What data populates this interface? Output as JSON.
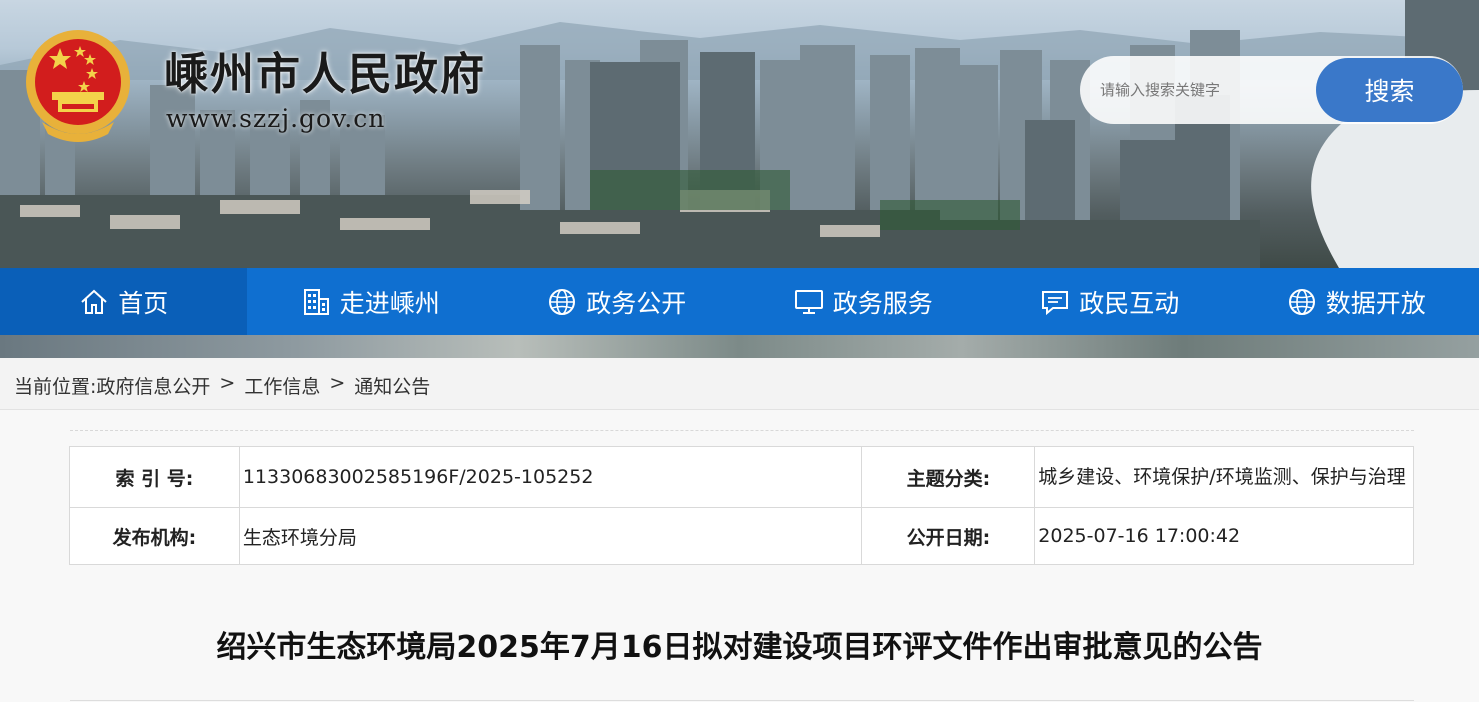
{
  "header": {
    "site_name": "嵊州市人民政府",
    "site_url": "www.szzj.gov.cn",
    "search_placeholder": "请输入搜索关键字",
    "search_button": "搜索"
  },
  "nav": {
    "items": [
      {
        "label": "首页",
        "icon": "home-icon"
      },
      {
        "label": "走进嵊州",
        "icon": "building-icon"
      },
      {
        "label": "政务公开",
        "icon": "globe-icon"
      },
      {
        "label": "政务服务",
        "icon": "monitor-icon"
      },
      {
        "label": "政民互动",
        "icon": "chat-icon"
      },
      {
        "label": "数据开放",
        "icon": "globe-icon"
      }
    ],
    "active_index": 0
  },
  "breadcrumb": {
    "prefix": "当前位置:",
    "items": [
      "政府信息公开",
      "工作信息",
      "通知公告"
    ],
    "separator": ">"
  },
  "info": {
    "index_label": "索 引 号:",
    "index_value": "11330683002585196F/2025-105252",
    "topic_label": "主题分类:",
    "topic_value": "城乡建设、环境保护/环境监测、保护与治理",
    "publisher_label": "发布机构:",
    "publisher_value": "生态环境分局",
    "date_label": "公开日期:",
    "date_value": "2025-07-16 17:00:42"
  },
  "article": {
    "title": "绍兴市生态环境局2025年7月16日拟对建设项目环评文件作出审批意见的公告"
  },
  "colors": {
    "nav_bg": "#0f6fd0",
    "nav_active": "#0a5fb8",
    "search_button": "#3a78c9"
  }
}
